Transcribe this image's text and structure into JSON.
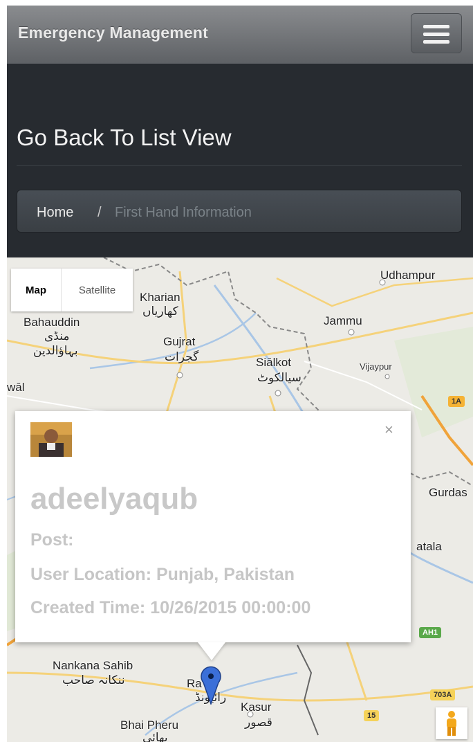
{
  "navbar": {
    "brand": "Emergency Management",
    "toggle_icon": "hamburger-menu-icon"
  },
  "header": {
    "title": "Go Back To List View",
    "breadcrumb": {
      "home": "Home",
      "separator": "/",
      "active": "First Hand Information"
    }
  },
  "map": {
    "type_controls": {
      "map": "Map",
      "satellite": "Satellite"
    },
    "places": {
      "udhampur": "Udhampur",
      "kharian": "Kharian",
      "kharian_ur": "کھاریاں",
      "bahauddin": "Bahauddin",
      "bahauddin_ur1": "منڈی",
      "bahauddin_ur2": "بہاؤالدین",
      "jammu": "Jammu",
      "gujrat": "Gujrat",
      "gujrat_ur": "گجرات",
      "sialkot": "Siālkot",
      "sialkot_ur": "سیالکوٹ",
      "vijaypur": "Vijaypur",
      "wal": "wāl",
      "gurdas": "Gurdas",
      "atala": "atala",
      "nankana": "Nankana Sahib",
      "nankana_ur": "ننکانہ صاحب",
      "raiwind": "Ra  nd",
      "raiwind_ur": "رائیونڈ",
      "kasur": "Kasur",
      "kasur_ur": "قصور",
      "bhai_pheru": "Bhai Pheru",
      "bhai_pheru_ur": "بھائی"
    },
    "shields": {
      "s1a": "1A",
      "ah1": "AH1",
      "s703a": "703A",
      "s15": "15"
    },
    "marker_icon": "map-pin-icon",
    "pegman_icon": "street-view-pegman-icon"
  },
  "infowindow": {
    "username": "adeelyaqub",
    "post": "Post:",
    "location": "User Location: Punjab, Pakistan",
    "created": "Created Time: 10/26/2015 00:00:00",
    "close": "×"
  }
}
